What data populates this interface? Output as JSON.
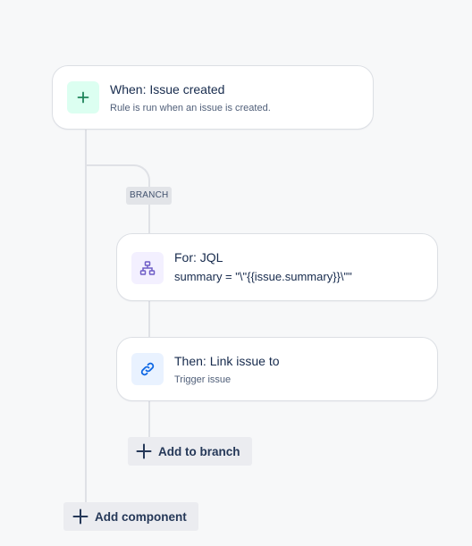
{
  "trigger": {
    "title": "When: Issue created",
    "subtitle": "Rule is run when an issue is created.",
    "icon": "plus-icon",
    "icon_color": "#1f845a",
    "icon_bg": "#dcfff1"
  },
  "branch": {
    "label": "BRANCH"
  },
  "for_jql": {
    "title": "For: JQL",
    "query": "summary = \"\\\"{{issue.summary}}\\\"\"",
    "icon": "branch-hierarchy-icon",
    "icon_color": "#6e5dc6",
    "icon_bg": "#f3f0ff"
  },
  "link_action": {
    "title": "Then: Link issue to",
    "subtitle": "Trigger issue",
    "icon": "link-icon",
    "icon_color": "#0c66e4",
    "icon_bg": "#e9f2ff"
  },
  "add_to_branch": {
    "label": "Add to branch"
  },
  "add_component": {
    "label": "Add component"
  },
  "colors": {
    "background": "#f7f8f9",
    "connector": "#dfe1e6",
    "card_border": "#dcdfe4",
    "button_bg": "#ebecf0"
  }
}
